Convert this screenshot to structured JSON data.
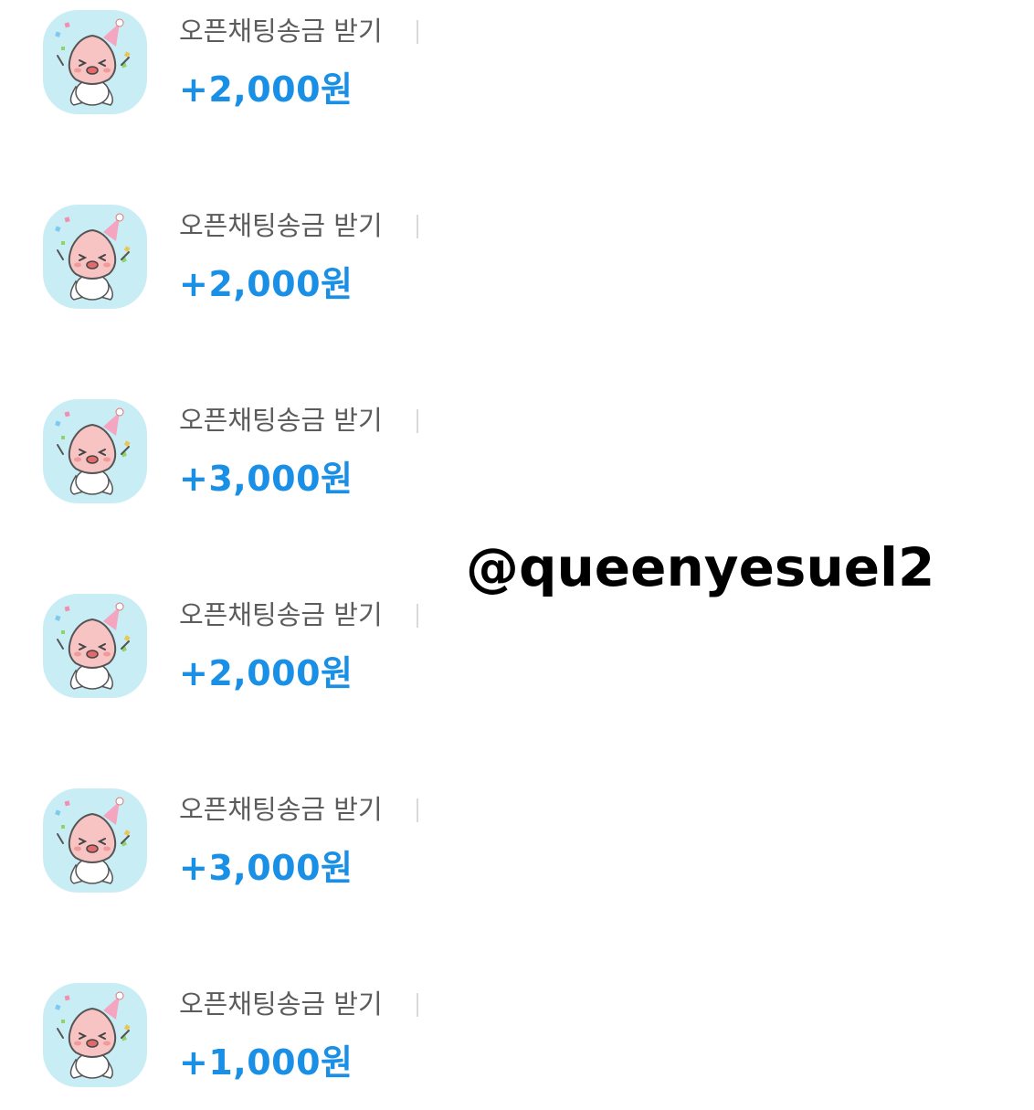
{
  "transactions": [
    {
      "description": "오픈채팅송금 받기",
      "amount": "+2,000원",
      "icon": "apeach-party-icon"
    },
    {
      "description": "오픈채팅송금 받기",
      "amount": "+2,000원",
      "icon": "apeach-party-icon"
    },
    {
      "description": "오픈채팅송금 받기",
      "amount": "+3,000원",
      "icon": "apeach-party-icon"
    },
    {
      "description": "오픈채팅송금 받기",
      "amount": "+2,000원",
      "icon": "apeach-party-icon"
    },
    {
      "description": "오픈채팅송금 받기",
      "amount": "+3,000원",
      "icon": "apeach-party-icon"
    },
    {
      "description": "오픈채팅송금 받기",
      "amount": "+1,000원",
      "icon": "apeach-party-icon"
    }
  ],
  "watermark": "@queenyesuel2",
  "colors": {
    "amount": "#1a8fe6",
    "description": "#5b5b5b",
    "icon_background": "#c9edf5",
    "character": "#f7c3c3"
  }
}
